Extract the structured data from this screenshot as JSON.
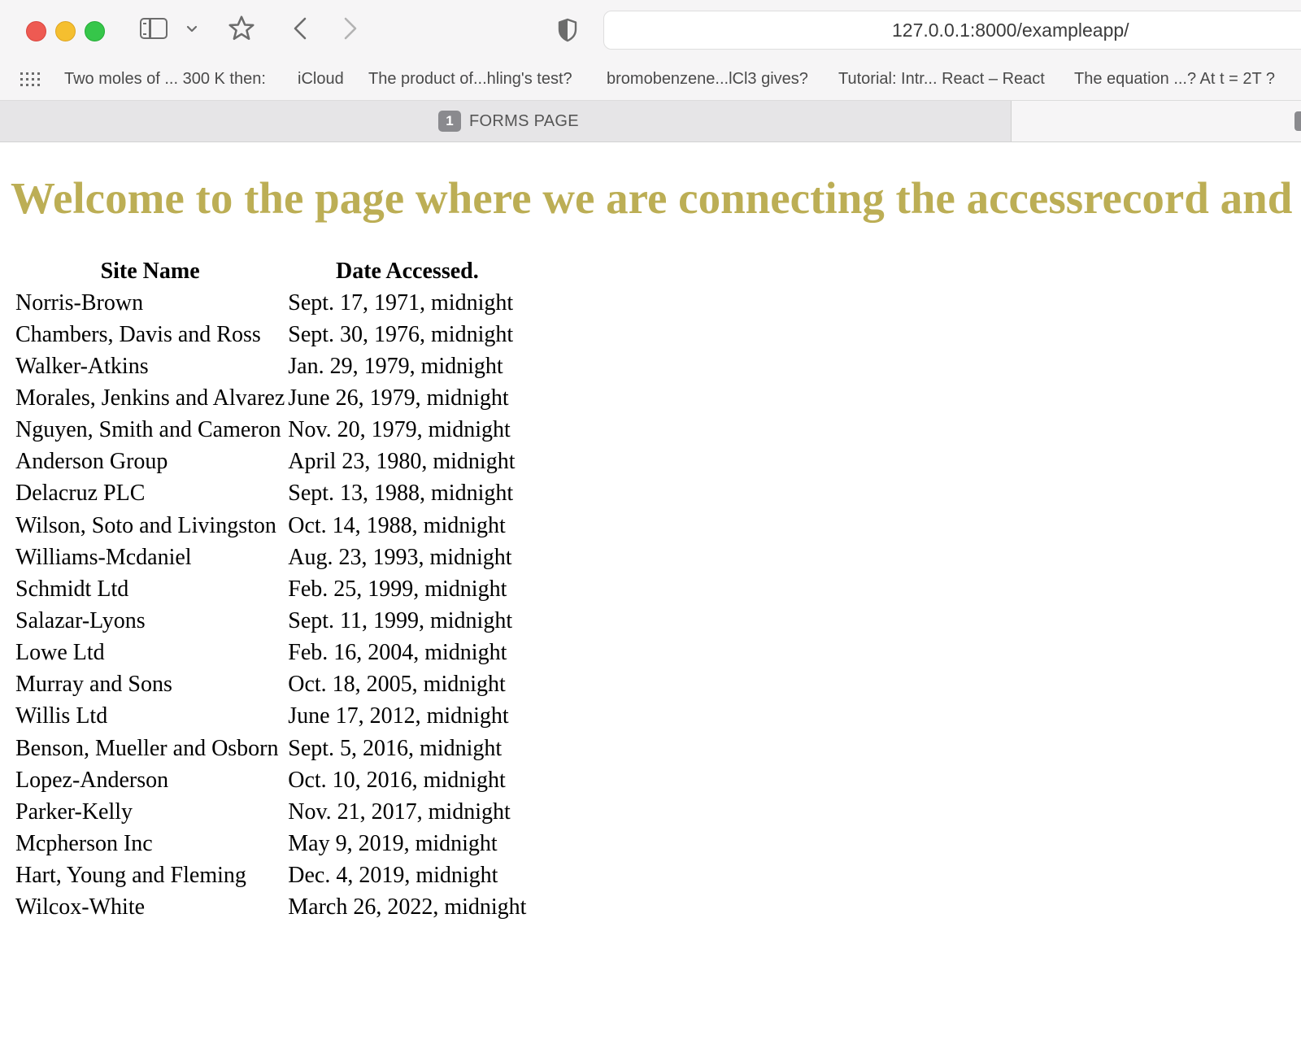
{
  "browser": {
    "url": "127.0.0.1:8000/exampleapp/",
    "bookmarks": [
      "Two moles of ... 300 K then:",
      "iCloud",
      "The product of...hling's test?",
      "bromobenzene...lCl3 gives?",
      "Tutorial: Intr... React – React",
      "The equation ...? At t = 2T ?"
    ],
    "tab": {
      "badge": "1",
      "title": "FORMS PAGE"
    }
  },
  "icons": {
    "sidebar": "sidebar-icon",
    "chevron": "chevron-down-icon",
    "bookmark": "star-icon",
    "back": "back-icon",
    "forward": "forward-icon",
    "privacy": "shield-icon",
    "bookmarks_grid": "grid-icon"
  },
  "colors": {
    "heading": "#bcae55",
    "traffic_red": "#ee5a52",
    "traffic_yellow": "#f5bf2f",
    "traffic_green": "#36c64a"
  },
  "page": {
    "heading": "Welcome to the page where we are connecting the accessrecord and webpage models",
    "table": {
      "headers": [
        "Site Name",
        "Date Accessed."
      ],
      "rows": [
        [
          "Norris-Brown",
          "Sept. 17, 1971, midnight"
        ],
        [
          "Chambers, Davis and Ross",
          "Sept. 30, 1976, midnight"
        ],
        [
          "Walker-Atkins",
          "Jan. 29, 1979, midnight"
        ],
        [
          "Morales, Jenkins and Alvarez",
          "June 26, 1979, midnight"
        ],
        [
          "Nguyen, Smith and Cameron",
          "Nov. 20, 1979, midnight"
        ],
        [
          "Anderson Group",
          "April 23, 1980, midnight"
        ],
        [
          "Delacruz PLC",
          "Sept. 13, 1988, midnight"
        ],
        [
          "Wilson, Soto and Livingston",
          "Oct. 14, 1988, midnight"
        ],
        [
          "Williams-Mcdaniel",
          "Aug. 23, 1993, midnight"
        ],
        [
          "Schmidt Ltd",
          "Feb. 25, 1999, midnight"
        ],
        [
          "Salazar-Lyons",
          "Sept. 11, 1999, midnight"
        ],
        [
          "Lowe Ltd",
          "Feb. 16, 2004, midnight"
        ],
        [
          "Murray and Sons",
          "Oct. 18, 2005, midnight"
        ],
        [
          "Willis Ltd",
          "June 17, 2012, midnight"
        ],
        [
          "Benson, Mueller and Osborn",
          "Sept. 5, 2016, midnight"
        ],
        [
          "Lopez-Anderson",
          "Oct. 10, 2016, midnight"
        ],
        [
          "Parker-Kelly",
          "Nov. 21, 2017, midnight"
        ],
        [
          "Mcpherson Inc",
          "May 9, 2019, midnight"
        ],
        [
          "Hart, Young and Fleming",
          "Dec. 4, 2019, midnight"
        ],
        [
          "Wilcox-White",
          "March 26, 2022, midnight"
        ]
      ]
    }
  }
}
